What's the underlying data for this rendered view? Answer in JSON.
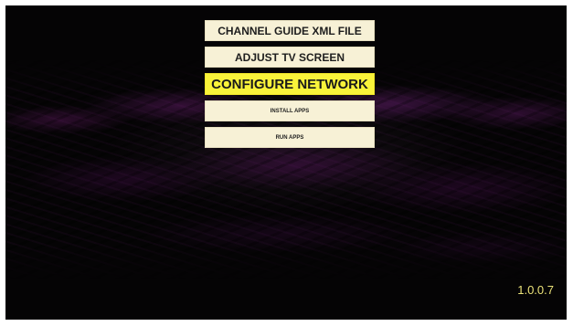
{
  "menu": {
    "items": [
      {
        "label": "CHANNEL GUIDE XML FILE"
      },
      {
        "label": "ADJUST TV SCREEN"
      },
      {
        "label": "CONFIGURE NETWORK"
      },
      {
        "label": "INSTALL APPS"
      },
      {
        "label": "RUN APPS"
      }
    ],
    "selected_label": "CONFIGURE NETWORK"
  },
  "version": "1.0.0.7",
  "colors": {
    "item_background": "#f7f1d6",
    "selected_background": "#f9f33a",
    "version_text": "#ece37a",
    "screen_background": "#030303"
  }
}
